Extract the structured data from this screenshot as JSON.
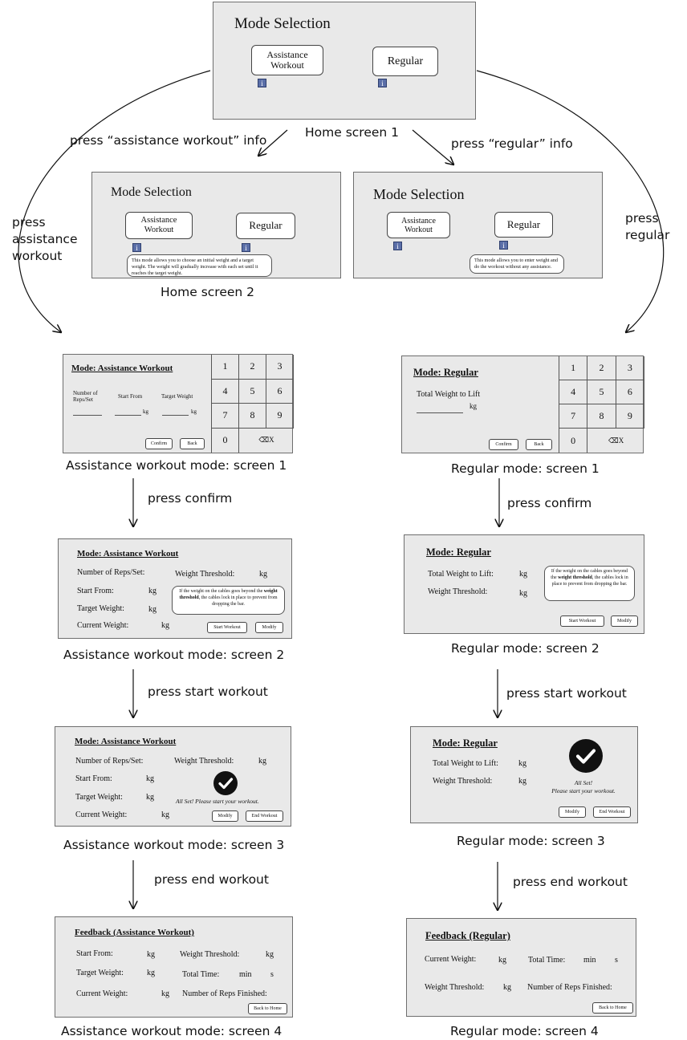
{
  "captions": {
    "home1": "Home screen 1",
    "home2": "Home screen 2",
    "aw1": "Assistance workout mode: screen 1",
    "aw2": "Assistance workout mode: screen 2",
    "aw3": "Assistance workout mode: screen 3",
    "aw4": "Assistance workout mode: screen 4",
    "rg1": "Regular mode: screen 1",
    "rg2": "Regular mode: screen 2",
    "rg3": "Regular mode: screen 3",
    "rg4": "Regular mode: screen 4"
  },
  "flow": {
    "assist_info": "press “assistance workout” info",
    "regular_info": "press “regular” info",
    "press_assist_1": "press",
    "press_assist_2": "assistance",
    "press_assist_3": "workout",
    "press_regular_1": "press",
    "press_regular_2": "regular",
    "confirm": "press confirm",
    "start": "press start workout",
    "end": "press end workout"
  },
  "mode_selection": {
    "title": "Mode Selection",
    "assist_1": "Assistance",
    "assist_2": "Workout",
    "regular": "Regular",
    "info_glyph": "i",
    "assist_tip": "This mode allows you to choose an initial weight and a target weight. The weight will gradually increase with each set until it reaches the target weight.",
    "regular_tip": "This mode allows you to enter weight and do the workout without any assistance."
  },
  "aw": {
    "title": "Mode: Assistance Workout",
    "reps_1": "Number of",
    "reps_2": "Reps/Set",
    "start_from": "Start From",
    "target_weight": "Target Weight",
    "kg": "kg",
    "confirm": "Confirm",
    "back": "Back",
    "reps_label": "Number of Reps/Set:",
    "weight_threshold": "Weight Threshold:",
    "start_from_c": "Start From:",
    "target_weight_c": "Target Weight:",
    "current_weight": "Current Weight:",
    "start_workout": "Start Workout",
    "modify": "Modify",
    "end_workout": "End Workout",
    "tip_a": "If the weight on the cables goes beyond the ",
    "tip_b": "weight threshold",
    "tip_c": ", the cables lock in place to prevent from dropping the bar.",
    "all_set": "All Set! Please start your workout."
  },
  "rg": {
    "title": "Mode: Regular",
    "total_weight": "Total Weight to Lift",
    "total_weight_c": "Total Weight to Lift:",
    "weight_threshold": "Weight Threshold:",
    "kg": "kg",
    "confirm": "Confirm",
    "back": "Back",
    "start_workout": "Start Workout",
    "modify": "Modify",
    "end_workout": "End Workout",
    "tip_a": "If the weight on the cables goes beyond the ",
    "tip_b": "weight threshold",
    "tip_c": ", the cables lock in place to prevent from dropping the bar.",
    "all_set_1": "All Set!",
    "all_set_2": "Please start your workout."
  },
  "keypad": [
    "1",
    "2",
    "3",
    "4",
    "5",
    "6",
    "7",
    "8",
    "9",
    "0",
    "⌫X"
  ],
  "feedback": {
    "aw_title": "Feedback (Assistance Workout)",
    "rg_title": "Feedback (Regular)",
    "start_from": "Start From:",
    "target_weight": "Target Weight:",
    "current_weight": "Current Weight:",
    "weight_threshold": "Weight Threshold:",
    "total_time": "Total Time:",
    "reps_finished": "Number of Reps Finished:",
    "kg": "kg",
    "min": "min",
    "s": "s",
    "back_home": "Back to Home"
  },
  "colors": {
    "screen_bg": "#e9e9e9",
    "info_icon": "#5b6fa8"
  }
}
